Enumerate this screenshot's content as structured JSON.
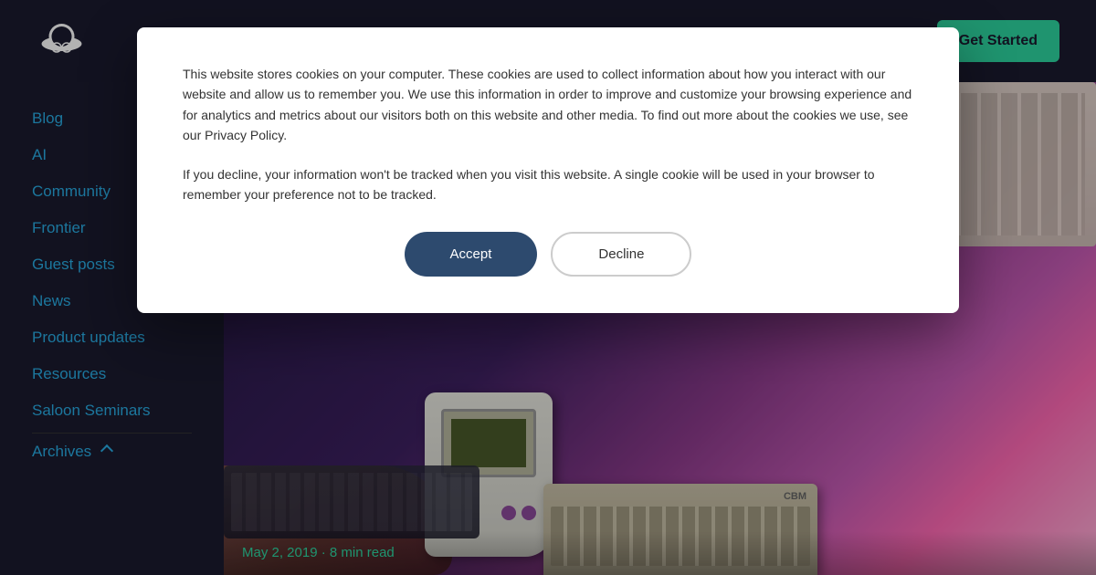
{
  "header": {
    "logo_alt": "Cowboy hat logo",
    "get_started_label": "Get Started"
  },
  "sidebar": {
    "items": [
      {
        "id": "blog",
        "label": "Blog"
      },
      {
        "id": "ai",
        "label": "AI"
      },
      {
        "id": "community",
        "label": "Community"
      },
      {
        "id": "frontier",
        "label": "Frontier"
      },
      {
        "id": "guest-posts",
        "label": "Guest posts"
      },
      {
        "id": "news",
        "label": "News"
      },
      {
        "id": "product-updates",
        "label": "Product updates"
      },
      {
        "id": "resources",
        "label": "Resources"
      },
      {
        "id": "saloon-seminars",
        "label": "Saloon Seminars"
      }
    ],
    "archives_label": "Archives"
  },
  "post": {
    "date": "May 2, 2019",
    "read_time": "8 min read",
    "date_separator": "·"
  },
  "cookie": {
    "text1": "This website stores cookies on your computer. These cookies are used to collect information about how you interact with our website and allow us to remember you. We use this information in order to improve and customize your browsing experience and for analytics and metrics about our visitors both on this website and other media. To find out more about the cookies we use, see our Privacy Policy.",
    "text2": "If you decline, your information won't be tracked when you visit this website. A single cookie will be used in your browser to remember your preference not to be tracked.",
    "privacy_link": "Privacy Policy",
    "accept_label": "Accept",
    "decline_label": "Decline"
  }
}
